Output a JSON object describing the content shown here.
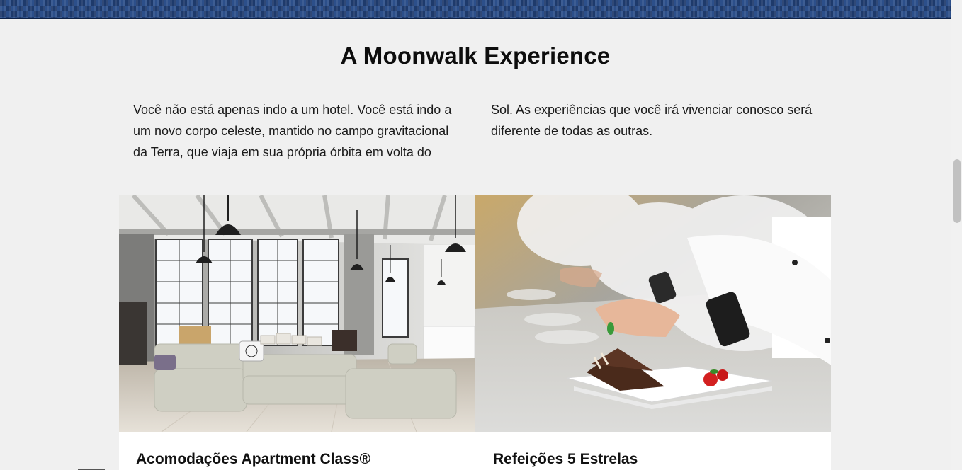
{
  "section": {
    "title": "A Moonwalk Experience",
    "intro": "Você não está apenas indo a um hotel. Você está indo a um novo corpo celeste, mantido no campo gravitacional da Terra, que viaja em sua própria órbita em volta do Sol. As experiências que você irá vivenciar conosco será diferente de todas as outras."
  },
  "cards": [
    {
      "title": "Acomodações Apartment Class®",
      "image": "loft-living-room-photo"
    },
    {
      "title": "Refeições 5 Estrelas",
      "image": "chef-plating-dessert-photo"
    }
  ],
  "colors": {
    "banner": "#1e3a6b",
    "background": "#f0f0f0",
    "card": "#ffffff",
    "text": "#111111"
  }
}
